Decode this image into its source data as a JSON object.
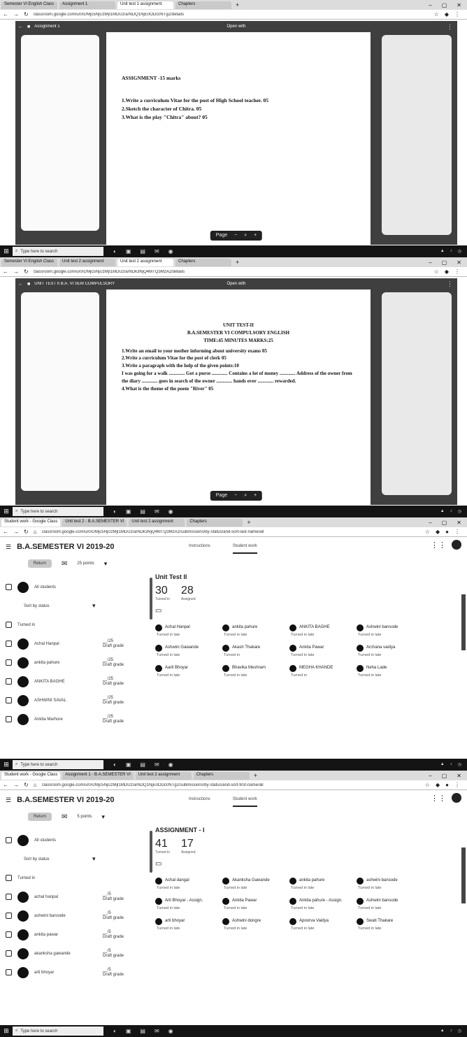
{
  "screens": [
    {
      "tabs": [
        "Semester VI English Class",
        "Assignment 1",
        "Unit test 1 assignment",
        "Chapters"
      ],
      "url": "classroom.google.com/u/0/c/Mjc5NjUzMjI1MDUz/a/NDQ1NjE0ODc0NTg2/details",
      "viewer_title": "Assignment 1",
      "viewer_open_with": "Open with",
      "doc_lines": [
        "ASSIGNMENT -15 marks",
        "1.Write a curriculum Vitae for the post of High School teacher.   05",
        "2.Sketch the character of Chitra.  05",
        "3.What is the play \"Chitra\" about?  05"
      ],
      "page_ctl": {
        "page": "Page",
        "zoom_out": "−",
        "zoom_in": "+"
      },
      "taskbar_search": "Type here to search"
    },
    {
      "tabs": [
        "Semester VI English Class",
        "Unit test 2 assignment",
        "Unit test 2 assignment",
        "Chapters"
      ],
      "url": "classroom.google.com/u/0/c/Mjc5NjUzMjI1MDUz/a/NDk3NjQ4MTQ3MzA2/details",
      "viewer_title": "UNIT TEST II B.A. VI SEM COMPULSORY",
      "viewer_open_with": "Open with",
      "doc_lines": [
        "UNIT TEST-II",
        "B.A.SEMESTER VI COMPULSORY ENGLISH",
        "TIME:45 MINUTES    MARKS:25",
        "1.Write an email to your mother informing about university exams 05",
        "2.Write a curriculum Vitae for the post of clerk 05",
        "3.Write a paragraph with the help of the given points:10",
        "I was going for a walk ............. Got a purse ............. Contains a lot of money ............. Address of the owner from the diary ............. goes in search of the owner ............. hands over ............. rewarded.",
        "4.What is the theme of the poem \"River\" 05"
      ],
      "page_ctl": {
        "page": "Page",
        "zoom_out": "−",
        "zoom_in": "+"
      },
      "taskbar_search": "Type here to search"
    }
  ],
  "classroom": [
    {
      "tabs": [
        "Student work - Google Class",
        "Unit test 2 - B.A.SEMESTER VI",
        "Unit test 2 assignment",
        "Chapters"
      ],
      "url": "classroom.google.com/u/0/c/Mjc5NjUzMjI1MDUz/a/NDk3NjQ4MTQ3MzA2/submissions/by-status/and-sort-last-name/all",
      "class_title": "B.A.SEMESTER VI 2019-20",
      "tab_instructions": "Instructions",
      "tab_student_work": "Student work",
      "return_btn": "Return",
      "points": "25 points",
      "all_students": "All students",
      "sort": "Sort by status",
      "group": "Turned in",
      "students": [
        {
          "name": "Achal Hanpal",
          "grade": "__/25",
          "sub": "Draft grade"
        },
        {
          "name": "ankita pahure",
          "grade": "__/25",
          "sub": "Draft grade"
        },
        {
          "name": "ANKITA BAGHE",
          "grade": "__/25",
          "sub": "Draft grade"
        },
        {
          "name": "ASHWINI SAVAL",
          "grade": "__/25",
          "sub": "Draft grade"
        },
        {
          "name": "Ankita Marhore",
          "grade": "__/25",
          "sub": "Draft grade"
        }
      ],
      "assignment": "Unit Test II",
      "turned_in": "30",
      "turned_in_lbl": "Turned in",
      "assigned": "28",
      "assigned_lbl": "Assigned",
      "cards": [
        {
          "name": "Achal Hanpal",
          "status": "Turned in late"
        },
        {
          "name": "ankita pahure",
          "status": "Turned in late"
        },
        {
          "name": "ANKITA BAGHE",
          "status": "Turned in late"
        },
        {
          "name": "Ashwini bansode",
          "status": "Turned in late"
        },
        {
          "name": "Ashwini Gawande",
          "status": "Turned in late"
        },
        {
          "name": "Akash Thakare",
          "status": "Turned in"
        },
        {
          "name": "Ankita Pawar",
          "status": "Turned in late"
        },
        {
          "name": "Archana vaidya",
          "status": "Turned in late"
        },
        {
          "name": "Aarti Bhoyar",
          "status": "Turned in late"
        },
        {
          "name": "Bhavika Meshram",
          "status": "Turned in late"
        },
        {
          "name": "MEGHA KHANDE",
          "status": "Turned in"
        },
        {
          "name": "Neha Lade",
          "status": "Turned in late"
        }
      ],
      "taskbar_search": "Type here to search"
    },
    {
      "tabs": [
        "Student work - Google Class",
        "Assignment 1 - B.A.SEMESTER VI",
        "Unit test 2 assignment",
        "Chapters"
      ],
      "url": "classroom.google.com/u/0/c/Mjc5NjUzMjI1MDUz/a/NDQ1NjE0ODc0NTg2/submissions/by-status/and-sort-first-name/all",
      "class_title": "B.A.SEMESTER VI 2019-20",
      "tab_instructions": "Instructions",
      "tab_student_work": "Student work",
      "return_btn": "Return",
      "points": "5 points",
      "all_students": "All students",
      "sort": "Sort by status",
      "group": "Turned in",
      "students": [
        {
          "name": "achal hanpal",
          "grade": "__/5",
          "sub": "Draft grade"
        },
        {
          "name": "ashwini bansode",
          "grade": "__/5",
          "sub": "Draft grade"
        },
        {
          "name": "ankita pawar",
          "grade": "__/5",
          "sub": "Draft grade"
        },
        {
          "name": "akanksha gawande",
          "grade": "__/5",
          "sub": "Draft grade"
        },
        {
          "name": "arti bhoyar",
          "grade": "__/5",
          "sub": "Draft grade"
        }
      ],
      "assignment": "ASSIGNMENT - I",
      "turned_in": "41",
      "turned_in_lbl": "Turned in",
      "assigned": "17",
      "assigned_lbl": "Assigned",
      "cards": [
        {
          "name": "Achal dangal",
          "status": "Turned in late"
        },
        {
          "name": "Akanksha Gawande",
          "status": "Turned in late"
        },
        {
          "name": "ankita pahure",
          "status": "Turned in late"
        },
        {
          "name": "ashwini bansode",
          "status": "Turned in late"
        },
        {
          "name": "Arti Bhoyar - Assign.",
          "status": "Turned in late"
        },
        {
          "name": "Ankita Pawar",
          "status": "Turned in late"
        },
        {
          "name": "Ankita pahure - Assign.",
          "status": "Turned in late"
        },
        {
          "name": "Ashwini bansode",
          "status": "Turned in late"
        },
        {
          "name": "arti bhoyar",
          "status": "Turned in late"
        },
        {
          "name": "Ashwini dongre",
          "status": "Turned in late"
        },
        {
          "name": "Apoorva Vaidya",
          "status": "Turned in late"
        },
        {
          "name": "Swati Thakare",
          "status": "Turned in late"
        }
      ],
      "taskbar_search": "Type here to search"
    }
  ]
}
